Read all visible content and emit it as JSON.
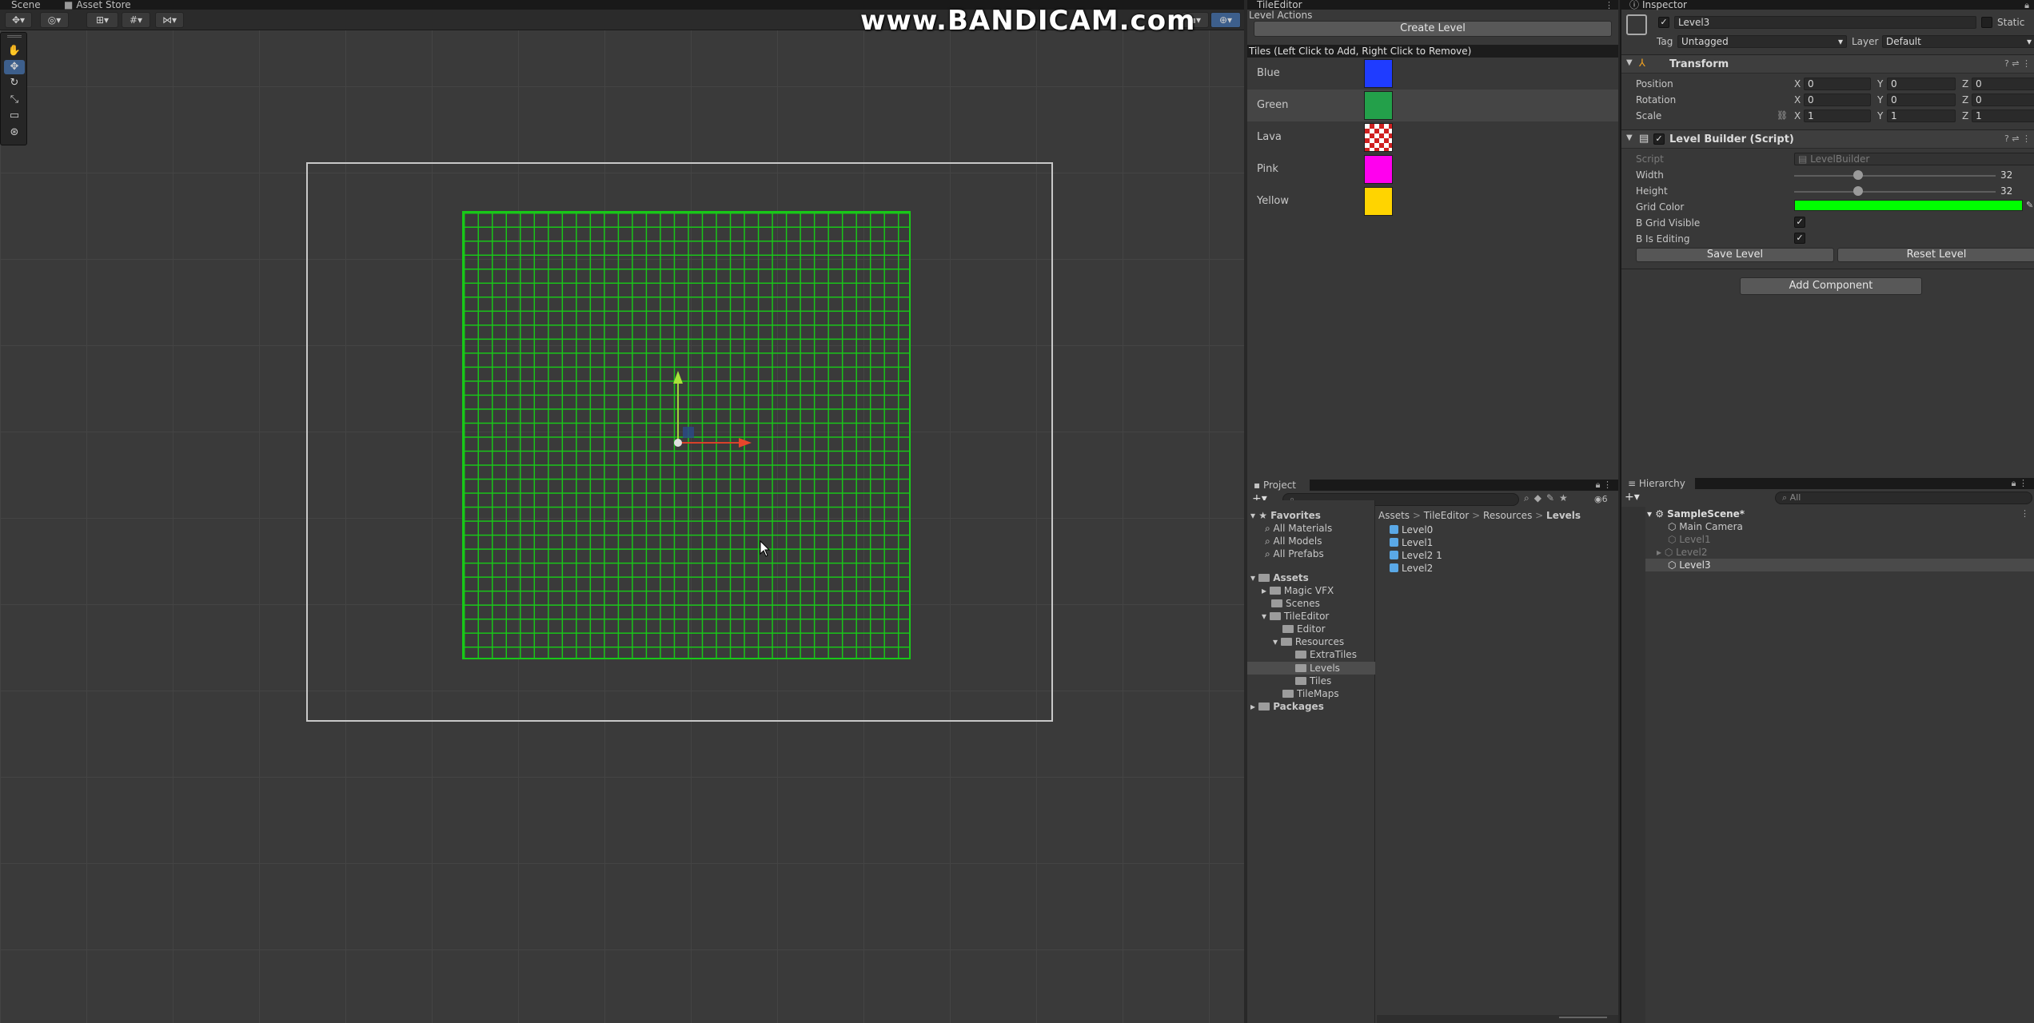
{
  "scene": {
    "tabs": [
      "Scene",
      "Asset Store"
    ],
    "watermark": "www.BANDICAM.com",
    "toolbar": [
      "transform-tools",
      "pivot",
      "grid-snap",
      "snap-increment",
      "camera",
      "gizmos"
    ],
    "tools": [
      "hand-tool",
      "move-tool",
      "rotate-tool",
      "scale-tool",
      "rect-tool",
      "transform-tool"
    ],
    "active_tool": "move-tool"
  },
  "tile_editor": {
    "title": "TileEditor",
    "actions_label": "Level Actions",
    "create_label": "Create Level",
    "tiles_header": "Tiles (Left Click to Add, Right Click to Remove)",
    "tiles": [
      {
        "name": "Blue",
        "color": "#1f3cff"
      },
      {
        "name": "Green",
        "color": "#23a04a"
      },
      {
        "name": "Lava",
        "color": "checker-red"
      },
      {
        "name": "Pink",
        "color": "#ff00ee"
      },
      {
        "name": "Yellow",
        "color": "#ffd400"
      }
    ],
    "selected_tile": "Green"
  },
  "inspector": {
    "title": "Inspector",
    "object_name": "Level3",
    "static_label": "Static",
    "tag_label": "Tag",
    "tag_value": "Untagged",
    "layer_label": "Layer",
    "layer_value": "Default",
    "transform": {
      "title": "Transform",
      "position_label": "Position",
      "rotation_label": "Rotation",
      "scale_label": "Scale",
      "position": {
        "x": "0",
        "y": "0",
        "z": "0"
      },
      "rotation": {
        "x": "0",
        "y": "0",
        "z": "0"
      },
      "scale": {
        "x": "1",
        "y": "1",
        "z": "1"
      }
    },
    "level_builder": {
      "title": "Level Builder (Script)",
      "script_label": "Script",
      "script_value": "LevelBuilder",
      "width_label": "Width",
      "width_value": "32",
      "height_label": "Height",
      "height_value": "32",
      "grid_color_label": "Grid Color",
      "grid_color": "#00ff00",
      "grid_visible_label": "B Grid Visible",
      "is_editing_label": "B Is Editing",
      "grid_visible": true,
      "is_editing": true,
      "save_label": "Save Level",
      "reset_label": "Reset Level"
    },
    "add_component_label": "Add Component"
  },
  "project": {
    "title": "Project",
    "favorites_label": "Favorites",
    "favorites": [
      "All Materials",
      "All Models",
      "All Prefabs"
    ],
    "assets_label": "Assets",
    "folders": [
      "Magic VFX",
      "Scenes",
      "TileEditor",
      "Editor",
      "Resources",
      "ExtraTiles",
      "Levels",
      "Tiles",
      "TileMaps"
    ],
    "packages_label": "Packages",
    "breadcrumb": [
      "Assets",
      "TileEditor",
      "Resources",
      "Levels"
    ],
    "breadcrumb_sep": ">",
    "assets": [
      "Level0",
      "Level1",
      "Level2 1",
      "Level2"
    ],
    "count_badge": "6"
  },
  "hierarchy": {
    "title": "Hierarchy",
    "search_placeholder": "All",
    "scene_name": "SampleScene*",
    "items": [
      {
        "name": "Main Camera",
        "dim": false
      },
      {
        "name": "Level1",
        "dim": true
      },
      {
        "name": "Level2",
        "dim": true
      },
      {
        "name": "Level3",
        "dim": false
      }
    ]
  }
}
